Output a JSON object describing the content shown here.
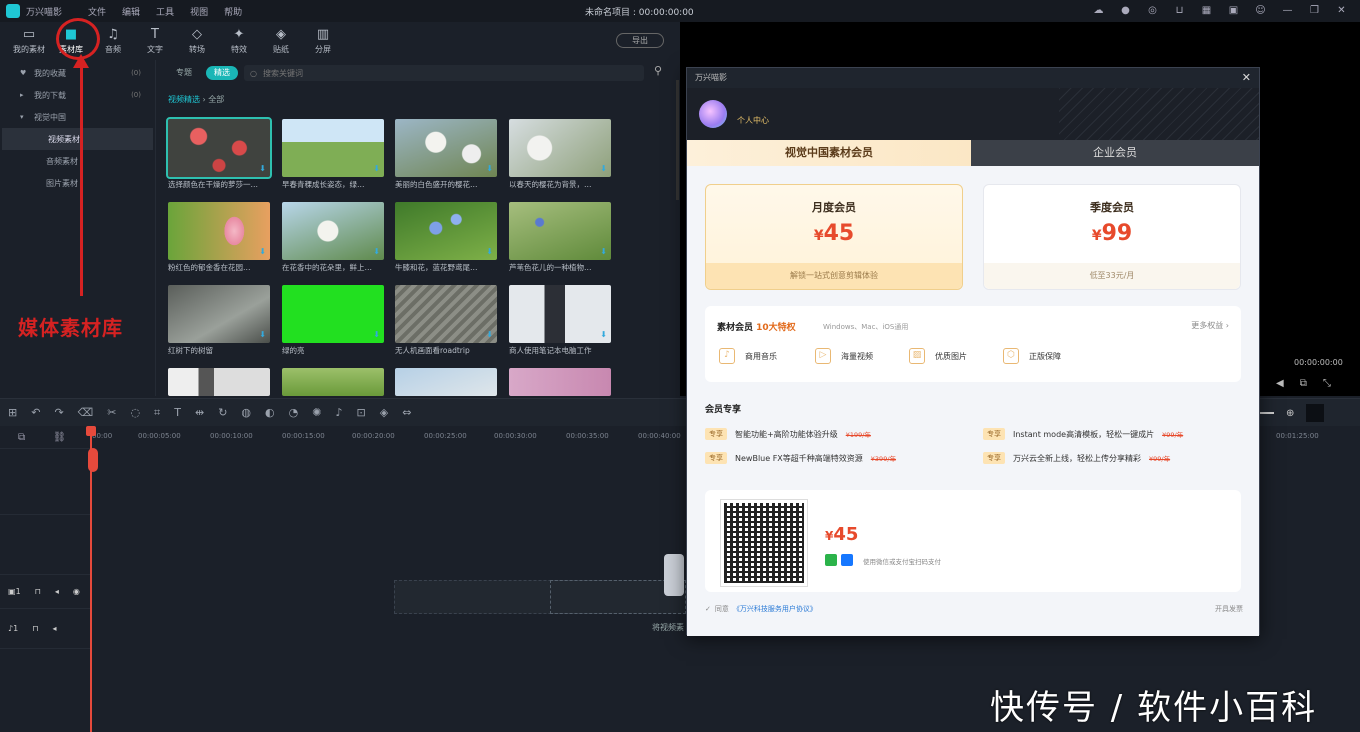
{
  "titlebar": {
    "app_name": "万兴喵影",
    "menus": [
      "文件",
      "编辑",
      "工具",
      "视图",
      "帮助"
    ],
    "project_title": "未命名项目 : 00:00:00:00"
  },
  "toolbar": {
    "items": [
      {
        "label": "我的素材",
        "icon": "folder-icon"
      },
      {
        "label": "素材库",
        "icon": "library-icon",
        "active": true
      },
      {
        "label": "音频",
        "icon": "music-icon"
      },
      {
        "label": "文字",
        "icon": "text-icon"
      },
      {
        "label": "转场",
        "icon": "transition-icon"
      },
      {
        "label": "特效",
        "icon": "effects-icon"
      },
      {
        "label": "贴纸",
        "icon": "sticker-icon"
      },
      {
        "label": "分屏",
        "icon": "splitscreen-icon"
      }
    ],
    "export_label": "导出"
  },
  "annotation": {
    "label": "媒体素材库",
    "color": "#d62222"
  },
  "tree": {
    "items": [
      {
        "label": "我的收藏",
        "count": "(0)",
        "caret": "♥"
      },
      {
        "label": "我的下载",
        "count": "(0)",
        "caret": "▸"
      },
      {
        "label": "视觉中国",
        "count": "",
        "caret": "▾"
      },
      {
        "label": "视频素材",
        "count": "",
        "sub": true,
        "selected": true
      },
      {
        "label": "音频素材",
        "count": "",
        "sub": true
      },
      {
        "label": "图片素材",
        "count": "",
        "sub": true
      }
    ]
  },
  "browser": {
    "filters": [
      "专题",
      "精选"
    ],
    "search_placeholder": "搜索关键词",
    "breadcrumb_main": "视频精选",
    "breadcrumb_rest": " › 全部",
    "captions": [
      "选择颜色在干燥的萝莎一…",
      "早春青稞成长姿态，绿…",
      "美丽的白色盛开的樱花…",
      "以春天的樱花为背景，…",
      "粉红色的郁金香在花园…",
      "在花香中的花朵里，鲜上…",
      "牛膝和花，蓝花野鸢尾…",
      "芦苇色花儿的一种植物…",
      "红树下的树留",
      "绿的亮",
      "无人机画面看roadtrip",
      "商人使用笔记本电脑工作"
    ]
  },
  "preview": {
    "time": "00:00:00:00"
  },
  "timeline": {
    "ruler": [
      "00:00",
      "00:00:05:00",
      "00:00:10:00",
      "00:00:15:00",
      "00:00:20:00",
      "00:00:25:00",
      "00:00:30:00",
      "00:00:35:00",
      "00:00:40:00"
    ],
    "ruler_right": "00:01:25:00",
    "drop_label": "将视频素",
    "tracks": [
      {
        "label": "1"
      },
      {
        "label": "1"
      }
    ]
  },
  "modal": {
    "title": "万兴喵影",
    "username": "个人中心",
    "tab_a": "视觉中国素材会员",
    "tab_b": "企业会员",
    "plans": [
      {
        "name": "月度会员",
        "currency": "¥",
        "price": "45",
        "footer": "解锁一站式创意剪辑体验"
      },
      {
        "name": "季度会员",
        "currency": "¥",
        "price": "99",
        "footer": "低至33元/月"
      }
    ],
    "perks_title_a": "素材会员",
    "perks_title_b": " 10大特权",
    "perks_sub": "Windows、Mac、iOS通用",
    "perks_more": "更多权益 ›",
    "perks": [
      {
        "label": "商用音乐",
        "icon": "music-note-icon"
      },
      {
        "label": "海量视频",
        "icon": "video-icon"
      },
      {
        "label": "优质图片",
        "icon": "image-icon"
      },
      {
        "label": "正版保障",
        "icon": "shield-icon"
      }
    ],
    "exclusive_title": "会员专享",
    "exclusive": [
      {
        "tag": "专享",
        "text": "智能功能+高阶功能体验升级",
        "strike": "¥199/年"
      },
      {
        "tag": "专享",
        "text": "Instant mode高清模板，轻松一键成片",
        "strike": "¥99/年"
      },
      {
        "tag": "专享",
        "text": "NewBlue FX等超千种高端特效资源",
        "strike": "¥399/年"
      },
      {
        "tag": "专享",
        "text": "万兴云全新上线，轻松上传分享精彩",
        "strike": "¥99/年"
      }
    ],
    "pay_currency": "¥",
    "pay_price": "45",
    "pay_note": "使用微信或支付宝扫码支付",
    "agree_prefix": "同意",
    "agree_link": "《万兴科技服务用户协议》",
    "invoice": "开具发票"
  },
  "watermark": "快传号 / 软件小百科"
}
